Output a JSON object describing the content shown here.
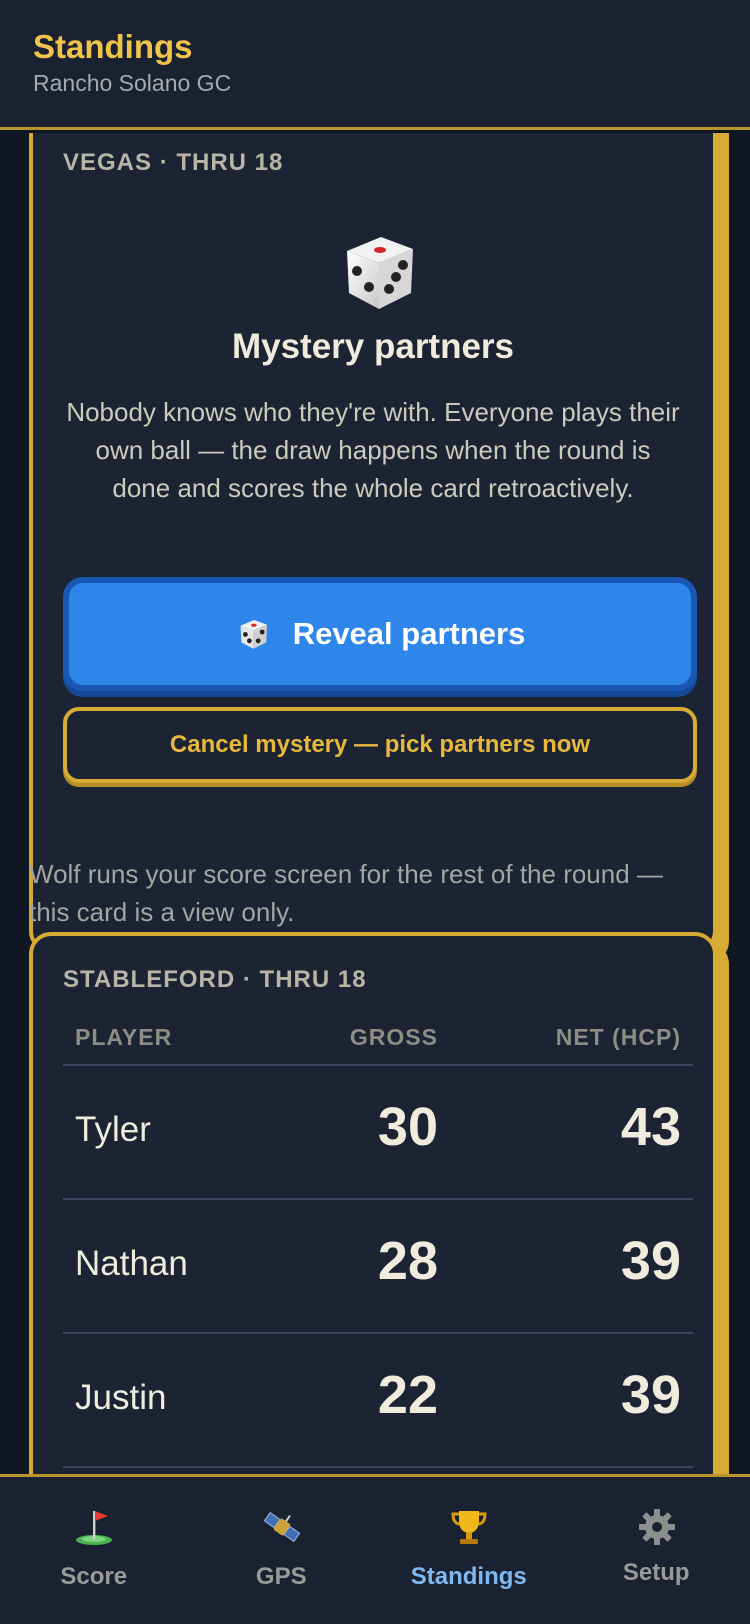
{
  "header": {
    "title": "Standings",
    "subtitle": "Rancho Solano GC"
  },
  "vegas": {
    "label": "VEGAS · THRU 18",
    "title": "Mystery partners",
    "body": "Nobody knows who they're with. Everyone plays their own ball — the draw happens when the round is done and scores the whole card retroactively.",
    "reveal_label": "Reveal partners",
    "cancel_label": "Cancel mystery — pick partners now"
  },
  "wolf_note": "Wolf runs your score screen for the rest of the round — this card is a view only.",
  "stableford": {
    "label": "STABLEFORD · THRU 18",
    "columns": {
      "player": "PLAYER",
      "gross": "GROSS",
      "net": "NET (HCP)"
    },
    "rows": [
      {
        "name": "Tyler",
        "gross": "30",
        "net": "43"
      },
      {
        "name": "Nathan",
        "gross": "28",
        "net": "39"
      },
      {
        "name": "Justin",
        "gross": "22",
        "net": "39"
      }
    ]
  },
  "nav": {
    "items": [
      {
        "label": "Score",
        "icon": "golf-flag-icon"
      },
      {
        "label": "GPS",
        "icon": "satellite-icon"
      },
      {
        "label": "Standings",
        "icon": "trophy-icon",
        "active": true
      },
      {
        "label": "Setup",
        "icon": "gear-icon"
      }
    ]
  },
  "colors": {
    "accent_gold": "#d6ab33",
    "primary_blue": "#2e86ea",
    "active_nav": "#7eb8f2",
    "background": "#101623",
    "card": "#1c2433"
  }
}
